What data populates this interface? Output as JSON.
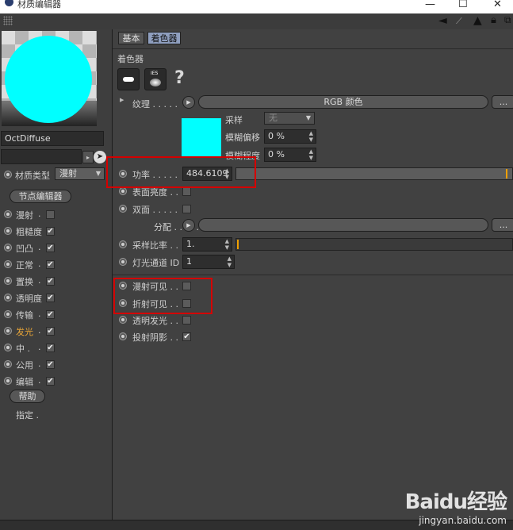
{
  "window": {
    "title": "材质编辑器",
    "controls": {
      "minimize": "—",
      "maximize": "☐",
      "close": "✕"
    }
  },
  "toolbar": {
    "icons": [
      "arrow-left-icon",
      "arrow-up-icon",
      "lock-icon",
      "new-window-icon"
    ]
  },
  "material": {
    "name": "OctDiffuse",
    "preview_color": "#00ffff",
    "type_label": "材质类型",
    "type_value": "漫射",
    "node_editor_button": "节点编辑器"
  },
  "channels": [
    {
      "label": "漫射",
      "checked": false,
      "active": false
    },
    {
      "label": "粗糙度",
      "checked": true,
      "active": false
    },
    {
      "label": "凹凸",
      "checked": true,
      "active": false
    },
    {
      "label": "正常",
      "checked": true,
      "active": false
    },
    {
      "label": "置换",
      "checked": true,
      "active": false
    },
    {
      "label": "透明度",
      "checked": true,
      "active": false
    },
    {
      "label": "传输",
      "checked": true,
      "active": false
    },
    {
      "label": "发光",
      "checked": true,
      "active": true
    },
    {
      "label": "中 .",
      "checked": true,
      "active": false
    },
    {
      "label": "公用",
      "checked": true,
      "active": false
    },
    {
      "label": "编辑",
      "checked": true,
      "active": false
    }
  ],
  "help_button": "帮助",
  "assign_label": "指定",
  "tabs": [
    {
      "label": "基本",
      "active": false
    },
    {
      "label": "着色器",
      "active": true
    }
  ],
  "section_title": "着色器",
  "question_mark": "?",
  "ies_label": "IES",
  "texture": {
    "label": "纹理",
    "button": "RGB 颜色",
    "more": "...",
    "swatch_color": "#00ffff",
    "sampling_label": "采样",
    "sampling_value": "无",
    "blur_offset_label": "模糊偏移",
    "blur_offset_value": "0 %",
    "blur_scale_label": "模糊程度",
    "blur_scale_value": "0 %"
  },
  "power": {
    "label": "功率",
    "value": "484.6109"
  },
  "surface_brightness": {
    "label": "表面亮度",
    "checked": false
  },
  "double_sided": {
    "label": "双面",
    "checked": false
  },
  "distribution": {
    "label": "分配",
    "more": "..."
  },
  "sample_rate": {
    "label": "采样比率",
    "value": "1."
  },
  "light_pass_id": {
    "label": "灯光通道 ID",
    "value": "1"
  },
  "visibility": [
    {
      "label": "漫射可见",
      "checked": false
    },
    {
      "label": "折射可见",
      "checked": false
    },
    {
      "label": "透明发光",
      "checked": false
    },
    {
      "label": "投射阴影",
      "checked": true
    }
  ],
  "watermark": {
    "brand": "Baidu经验",
    "url": "jingyan.baidu.com"
  }
}
